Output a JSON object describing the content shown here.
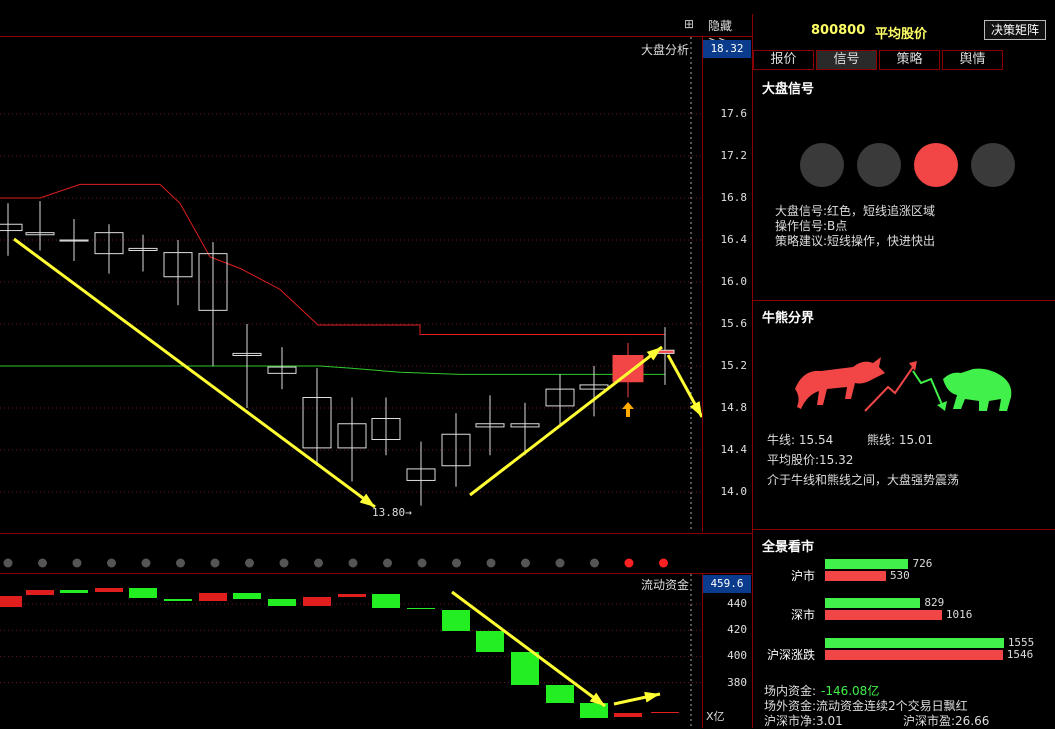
{
  "topbar": {
    "grid_icon": "grid-icon",
    "hide_label": "隐藏>>"
  },
  "main_chart": {
    "title": "大盘分析",
    "current_value": "18.32",
    "y_ticks": [
      "17.6",
      "17.2",
      "16.8",
      "16.4",
      "16.0",
      "15.6",
      "15.2",
      "14.8",
      "14.4",
      "14.0"
    ],
    "low_label": "13.80→"
  },
  "flow_chart": {
    "title": "流动资金",
    "current_value": "459.6",
    "y_ticks": [
      "440",
      "420",
      "400",
      "380"
    ],
    "unit": "X亿"
  },
  "right_panel": {
    "code": "800800",
    "name": "平均股价",
    "decision_button": "决策矩阵",
    "tabs": [
      "报价",
      "信号",
      "策略",
      "舆情"
    ],
    "active_tab": 1,
    "signal": {
      "title": "大盘信号",
      "lights": [
        "off",
        "off",
        "on",
        "off"
      ],
      "lines": [
        "大盘信号:红色，短线追涨区域",
        "操作信号:B点",
        "策略建议:短线操作，快进快出"
      ]
    },
    "bull_bear": {
      "title": "牛熊分界",
      "bull_line": "牛线: 15.54",
      "bear_line": "熊线: 15.01",
      "avg_price": "平均股价:15.32",
      "comment": "介于牛线和熊线之间，大盘强势震荡"
    },
    "panorama": {
      "title": "全景看市",
      "rows": [
        {
          "label": "沪市",
          "up": 726,
          "down": 530
        },
        {
          "label": "深市",
          "up": 829,
          "down": 1016
        },
        {
          "label": "沪深涨跌",
          "up": 1555,
          "down": 1546
        }
      ],
      "inner_funds_label": "场内资金:",
      "inner_funds_value": "-146.08亿",
      "outer_funds": "场外资金:流动资金连续2个交易日飘红",
      "hs_net": "沪深市净:3.01",
      "hs_profit": "沪深市盈:26.66"
    }
  },
  "colors": {
    "up": "#f24646",
    "down": "#41f04a",
    "border": "#8b0000",
    "arrow": "#ffff33"
  }
}
